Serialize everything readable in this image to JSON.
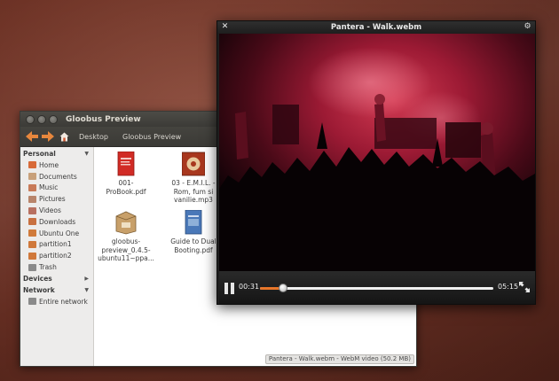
{
  "file_manager": {
    "title": "Gloobus Preview",
    "breadcrumbs": [
      "Desktop",
      "Gloobus Preview"
    ],
    "sidebar": {
      "sections": [
        {
          "label": "Personal",
          "items": [
            {
              "label": "Home",
              "icon": "home-folder-icon",
              "color": "#d86a38"
            },
            {
              "label": "Documents",
              "icon": "documents-folder-icon",
              "color": "#c8a07a"
            },
            {
              "label": "Music",
              "icon": "music-folder-icon",
              "color": "#c87a58"
            },
            {
              "label": "Pictures",
              "icon": "pictures-folder-icon",
              "color": "#b8846a"
            },
            {
              "label": "Videos",
              "icon": "videos-folder-icon",
              "color": "#b87060"
            },
            {
              "label": "Downloads",
              "icon": "downloads-folder-icon",
              "color": "#c87040"
            },
            {
              "label": "Ubuntu One",
              "icon": "ubuntu-one-folder-icon",
              "color": "#d07a3a"
            },
            {
              "label": "partition1",
              "icon": "drive-icon",
              "color": "#d0783a"
            },
            {
              "label": "partition2",
              "icon": "drive-icon",
              "color": "#d0783a"
            },
            {
              "label": "Trash",
              "icon": "trash-icon",
              "color": "#8a8a8a"
            }
          ]
        },
        {
          "label": "Devices",
          "items": []
        },
        {
          "label": "Network",
          "items": [
            {
              "label": "Entire network",
              "icon": "network-icon",
              "color": "#8a8a8a"
            }
          ]
        }
      ]
    },
    "files": [
      {
        "name": "001-\nProBook.pdf",
        "icon": "pdf-file-icon"
      },
      {
        "name": "03 - E.M.I.L. -\nRom, fum si\nvanilie.mp3",
        "icon": "audio-file-icon"
      },
      {
        "name": "gloobus-\npreview_0.4.5-\nubuntu11~ppa...",
        "icon": "package-file-icon"
      },
      {
        "name": "Guide to Dual\nBooting.pdf",
        "icon": "pdf-file-icon"
      }
    ],
    "status_text": "Pantera - Walk.webm - WebM video (50.2 MB)"
  },
  "preview": {
    "title": "Pantera - Walk.webm",
    "time_elapsed": "00:31",
    "time_total": "05:15",
    "progress": 0.098
  },
  "colors": {
    "accent": "#e8762a",
    "stage_light": "#c8203c"
  }
}
